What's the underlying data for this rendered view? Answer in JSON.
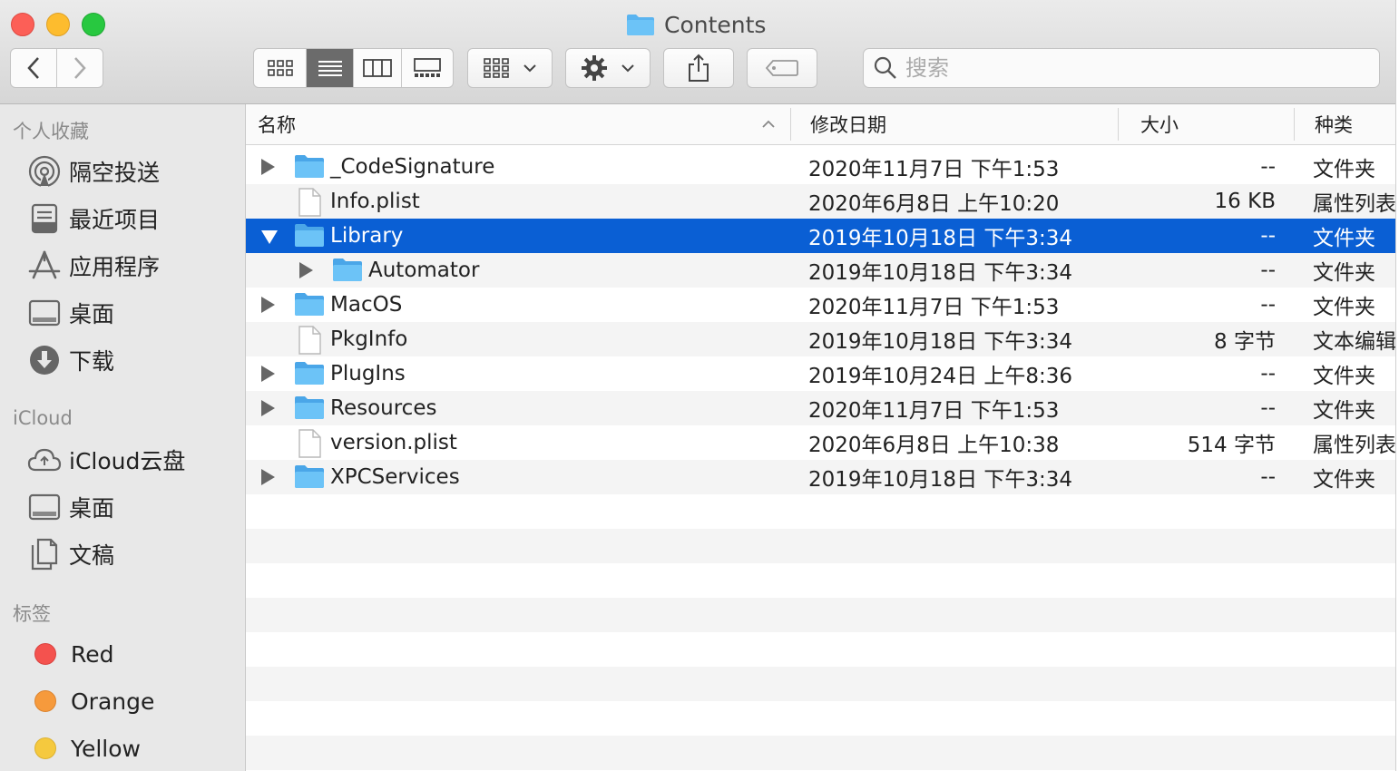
{
  "window": {
    "title": "Contents"
  },
  "toolbar": {
    "search_placeholder": "搜索",
    "view_modes": [
      "icon-view",
      "list-view",
      "column-view",
      "gallery-view"
    ],
    "active_view": "list-view"
  },
  "sidebar": {
    "favorites_title": "个人收藏",
    "favorites": [
      {
        "label": "隔空投送",
        "icon": "airdrop-icon"
      },
      {
        "label": "最近项目",
        "icon": "recents-icon"
      },
      {
        "label": "应用程序",
        "icon": "applications-icon"
      },
      {
        "label": "桌面",
        "icon": "desktop-icon"
      },
      {
        "label": "下载",
        "icon": "downloads-icon"
      }
    ],
    "icloud_title": "iCloud",
    "icloud": [
      {
        "label": "iCloud云盘",
        "icon": "icloud-drive-icon"
      },
      {
        "label": "桌面",
        "icon": "desktop-icon"
      },
      {
        "label": "文稿",
        "icon": "documents-icon"
      }
    ],
    "tags_title": "标签",
    "tags": [
      {
        "label": "Red",
        "color": "#f4524e"
      },
      {
        "label": "Orange",
        "color": "#f69a3c"
      },
      {
        "label": "Yellow",
        "color": "#f5c93e"
      }
    ]
  },
  "columns": {
    "name": "名称",
    "date": "修改日期",
    "size": "大小",
    "kind": "种类"
  },
  "files": [
    {
      "name": "_CodeSignature",
      "date": "2020年11月7日 下午1:53",
      "size": "--",
      "kind": "文件夹",
      "type": "folder",
      "disclosure": "collapsed",
      "indent": 0
    },
    {
      "name": "Info.plist",
      "date": "2020年6月8日 上午10:20",
      "size": "16 KB",
      "kind": "属性列表",
      "type": "file",
      "disclosure": "none",
      "indent": 0
    },
    {
      "name": "Library",
      "date": "2019年10月18日 下午3:34",
      "size": "--",
      "kind": "文件夹",
      "type": "folder",
      "disclosure": "expanded",
      "indent": 0,
      "selected": true
    },
    {
      "name": "Automator",
      "date": "2019年10月18日 下午3:34",
      "size": "--",
      "kind": "文件夹",
      "type": "folder",
      "disclosure": "collapsed",
      "indent": 1
    },
    {
      "name": "MacOS",
      "date": "2020年11月7日 下午1:53",
      "size": "--",
      "kind": "文件夹",
      "type": "folder",
      "disclosure": "collapsed",
      "indent": 0
    },
    {
      "name": "PkgInfo",
      "date": "2019年10月18日 下午3:34",
      "size": "8 字节",
      "kind": "文本编辑",
      "type": "file",
      "disclosure": "none",
      "indent": 0
    },
    {
      "name": "PlugIns",
      "date": "2019年10月24日 上午8:36",
      "size": "--",
      "kind": "文件夹",
      "type": "folder",
      "disclosure": "collapsed",
      "indent": 0
    },
    {
      "name": "Resources",
      "date": "2020年11月7日 下午1:53",
      "size": "--",
      "kind": "文件夹",
      "type": "folder",
      "disclosure": "collapsed",
      "indent": 0
    },
    {
      "name": "version.plist",
      "date": "2020年6月8日 上午10:38",
      "size": "514 字节",
      "kind": "属性列表",
      "type": "file",
      "disclosure": "none",
      "indent": 0
    },
    {
      "name": "XPCServices",
      "date": "2019年10月18日 下午3:34",
      "size": "--",
      "kind": "文件夹",
      "type": "folder",
      "disclosure": "collapsed",
      "indent": 0
    }
  ],
  "colors": {
    "selection": "#0a5fd4",
    "folder": "#5ab4f0"
  }
}
